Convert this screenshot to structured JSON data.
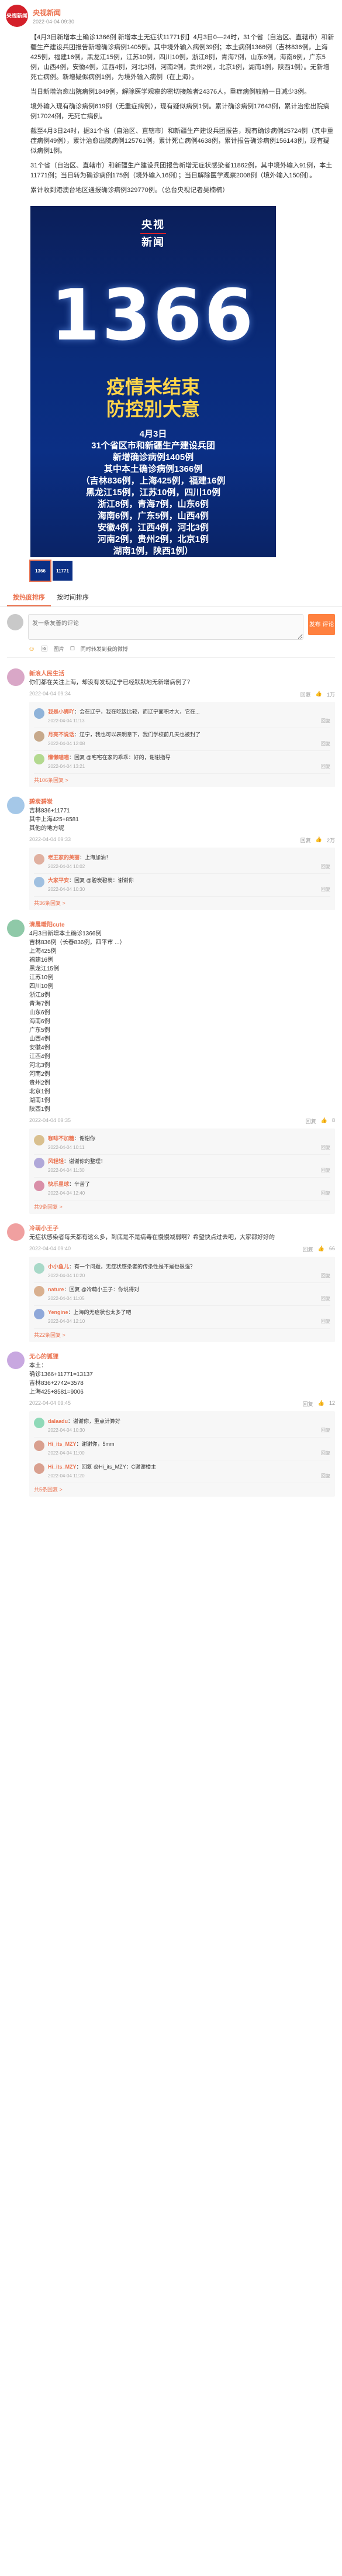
{
  "post": {
    "author": "央视新闻",
    "avatar_text": "央视新闻",
    "meta": "2022-04-04 09:30",
    "paragraphs": [
      "【4月3日新增本土确诊1366例 新增本土无症状11771例】4月3日0—24时，31个省（自治区、直辖市）和新疆生产建设兵团报告新增确诊病例1405例。其中境外输入病例39例；本土病例1366例（吉林836例，上海425例，福建16例，黑龙江15例，江苏10例，四川10例，浙江8例，青海7例，山东6例，海南6例，广东5例，山西4例，安徽4例，江西4例，河北3例，河南2例，贵州2例，北京1例，湖南1例，陕西1例）。无新增死亡病例。新增疑似病例1例，为境外输入病例（在上海）。",
      "当日新增治愈出院病例1849例，解除医学观察的密切接触者24376人，重症病例较前一日减少3例。",
      "境外输入现有确诊病例619例（无重症病例），现有疑似病例1例。累计确诊病例17643例，累计治愈出院病例17024例，无死亡病例。",
      "截至4月3日24时，据31个省（自治区、直辖市）和新疆生产建设兵团报告，现有确诊病例25724例（其中重症病例49例），累计治愈出院病例125761例，累计死亡病例4638例，累计报告确诊病例156143例，现有疑似病例1例。",
      "31个省（自治区、直辖市）和新疆生产建设兵团报告新增无症状感染者11862例，其中境外输入91例，本土11771例；当日转为确诊病例175例（境外输入16例）；当日解除医学观察2008例（境外输入150例）。",
      "累计收到港澳台地区通报确诊病例329770例。（总台央视记者吴楠楠）"
    ]
  },
  "poster": {
    "logo_top": "央视",
    "logo_bottom": "新闻",
    "number": "1366",
    "slogan_1": "疫情未结束",
    "slogan_2": "防控别大意",
    "lines": [
      "4月3日",
      "31个省区市和新疆生产建设兵团",
      "新增确诊病例1405例",
      "其中本土确诊病例1366例",
      "（吉林836例，上海425例，福建16例",
      "黑龙江15例，江苏10例，四川10例",
      "浙江8例，青海7例，山东6例",
      "海南6例，广东5例，山西4例",
      "安徽4例，江西4例，河北3例",
      "河南2例，贵州2例，北京1例",
      "湖南1例，陕西1例）"
    ],
    "thumbs": [
      "1366",
      "11771"
    ]
  },
  "tabs": [
    {
      "label": "按热度排序",
      "active": true
    },
    {
      "label": "按时间排序",
      "active": false
    }
  ],
  "comment_box": {
    "placeholder": "发一条友善的评论",
    "publish": "发布\n评论",
    "tool_image": "图片",
    "tool_forward": "同时转发到我的微博"
  },
  "comments": [
    {
      "user": "新浪人民生活",
      "avatar_color": "#d9a7c7",
      "text": "你们都在关注上海，却没有发现辽宁已经默默地无新增病例了？",
      "time": "2022-04-04 09:34",
      "likes": "1万",
      "replies": [
        {
          "user": "我是小狮吖",
          "color": "#8fb3d9",
          "text": "：会在辽宁，我在吃饭比较，而辽宁面积才大，它在...",
          "time": "2022-04-04 11:13"
        },
        {
          "user": "月亮不说话",
          "color": "#c7a98b",
          "text": "：辽宁，我也可以表明意下，我们学校前几天也被封了",
          "time": "2022-04-04 12:08"
        },
        {
          "user": "懒懒喵喵",
          "color": "#b3d98f",
          "text": "：回复 @宅宅在家的乖乖：好的，谢谢指导",
          "time": "2022-04-04 13:21"
        }
      ],
      "more": "共106条回复 >"
    },
    {
      "user": "碧炭碧炭",
      "avatar_color": "#a5c8e8",
      "text": "吉林836+11771\n其中上海425+8581\n其他的地方呢",
      "time": "2022-04-04 09:33",
      "likes": "2万",
      "replies": [
        {
          "user": "老王家的美丽",
          "color": "#e0b0a0",
          "text": "：上海加油！",
          "time": "2022-04-04 10:02"
        },
        {
          "user": "大家平安",
          "color": "#a0c0e0",
          "text": "：回复 @碧炭碧炭：谢谢你",
          "time": "2022-04-04 10:30"
        }
      ],
      "more": "共36条回复 >"
    },
    {
      "user": "清晨暖阳cute",
      "avatar_color": "#8fc9a8",
      "text": "4月3日新增本土确诊1366例\n吉林836例（长春836例，四平市 ...）\n上海425例\n福建16例\n黑龙江15例\n江苏10例\n四川10例\n浙江8例\n青海7例\n山东6例\n海南6例\n广东5例\n山西4例\n安徽4例\n江西4例\n河北3例\n河南2例\n贵州2例\n北京1例\n湖南1例\n陕西1例",
      "time": "2022-04-04 09:35",
      "likes": "8",
      "replies": [
        {
          "user": "咖啡不加糖",
          "color": "#d9c08f",
          "text": "：谢谢你",
          "time": "2022-04-04 10:11"
        },
        {
          "user": "风轻轻",
          "color": "#b0a8d9",
          "text": "：谢谢你的整理！",
          "time": "2022-04-04 11:30"
        },
        {
          "user": "快乐星球",
          "color": "#d98fa8",
          "text": "：辛苦了",
          "time": "2022-04-04 12:40"
        }
      ],
      "more": "共9条回复 >"
    },
    {
      "user": "冷萌小王子",
      "avatar_color": "#f0a0a0",
      "text": "无症状感染者每天都有这么多，到底是不是病毒在慢慢减弱啊？希望快点过去吧，大家都好好的",
      "time": "2022-04-04 09:40",
      "likes": "66",
      "replies": [
        {
          "user": "小小鱼儿",
          "color": "#a8d9c8",
          "text": "：有一个问题，无症状感染者的传染性是不是也很强？",
          "time": "2022-04-04 10:20"
        },
        {
          "user": "nature",
          "color": "#d9b08f",
          "text": "：回复 @冷萌小王子：你说得对",
          "time": "2022-04-04 11:05"
        },
        {
          "user": "Yengine",
          "color": "#8fa8d9",
          "text": "：上海的无症状也太多了吧",
          "time": "2022-04-04 12:10"
        }
      ],
      "more": "共22条回复 >"
    },
    {
      "user": "无心的狐狸",
      "avatar_color": "#c8a8e0",
      "text": "本土：\n确诊1366+11771=13137\n吉林836+2742=3578\n上海425+8581=9006",
      "time": "2022-04-04 09:45",
      "likes": "12",
      "replies": [
        {
          "user": "dalaadu",
          "color": "#8fd9b8",
          "text": "：谢谢你，重点计算好",
          "time": "2022-04-04 10:30"
        },
        {
          "user": "Hi_its_MZY",
          "color": "#d9a08f",
          "text": "：谢谢你，5mm",
          "time": "2022-04-04 11:00"
        },
        {
          "user": "Hi_its_MZY",
          "color": "#d9a08f",
          "text": "：回复 @Hi_its_MZY：C谢谢楼主",
          "time": "2022-04-04 11:20"
        }
      ],
      "more": "共5条回复 >"
    }
  ],
  "footer_box": {
    "placeholder": "发一条友善的评论"
  },
  "ui": {
    "reply_label": "回复",
    "like_icon": "thumb-up-icon"
  }
}
